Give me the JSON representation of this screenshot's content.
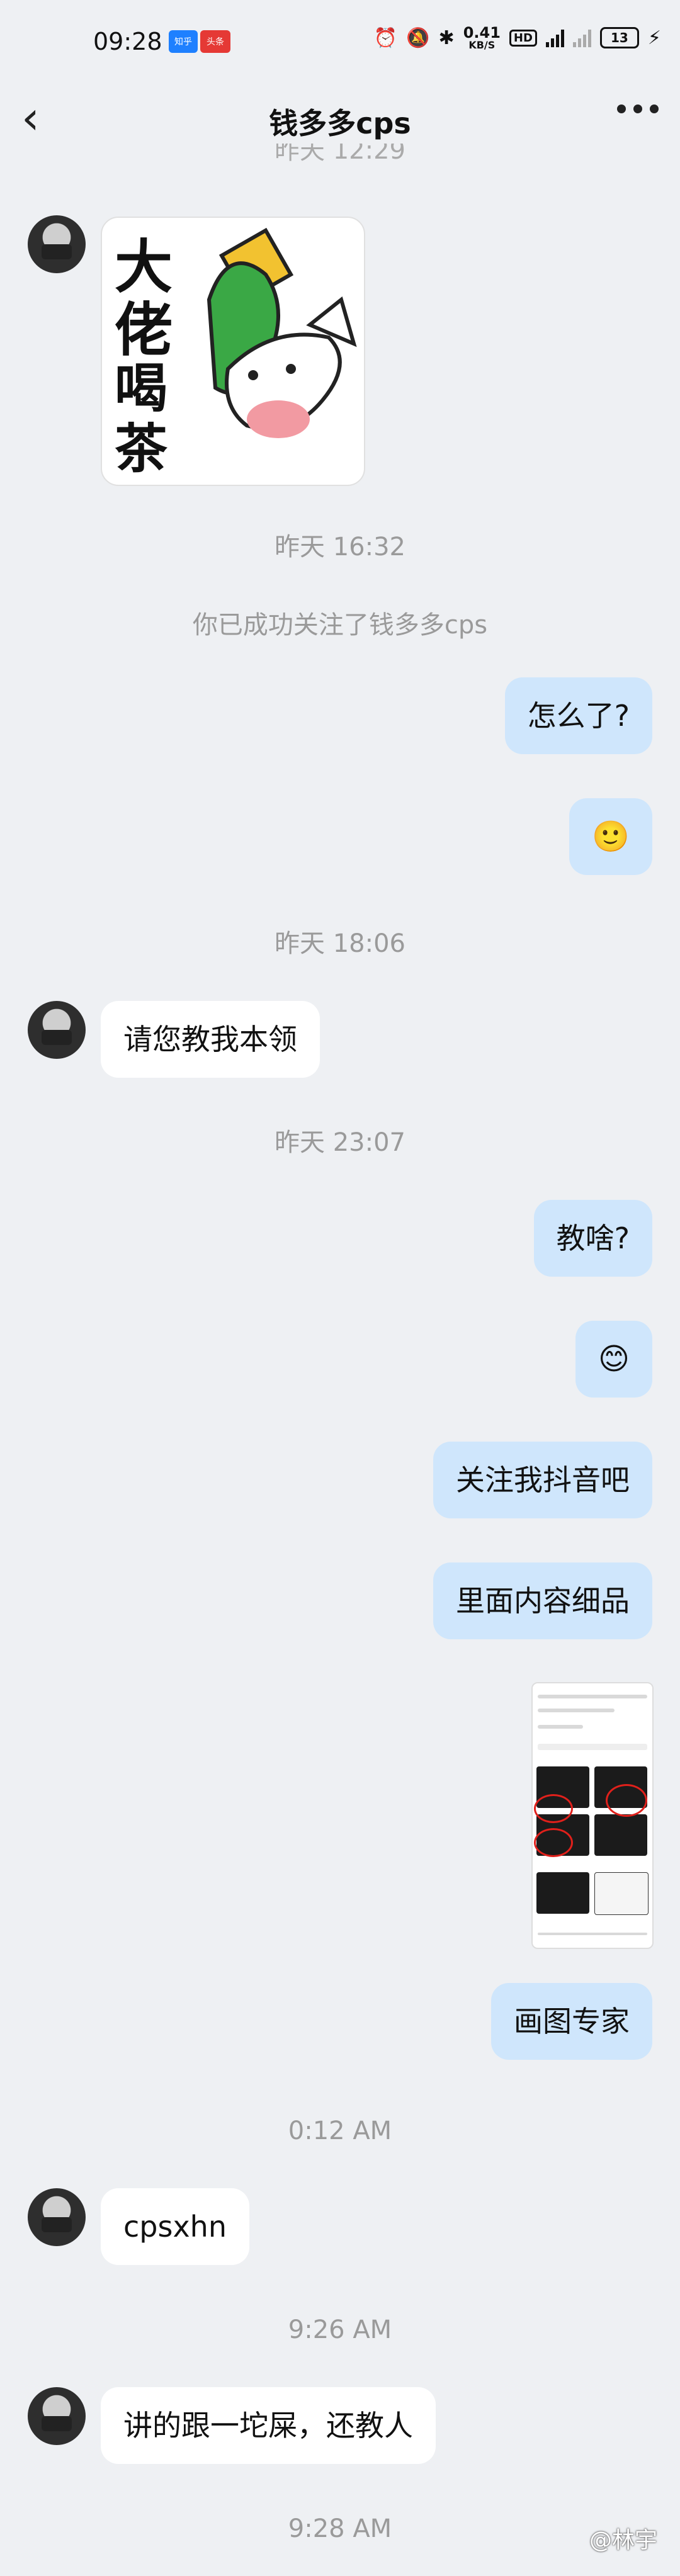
{
  "status_bar": {
    "time": "09:28",
    "badge_zhihu": "知乎",
    "badge_toutiao": "头条",
    "speed_value": "0.41",
    "speed_unit": "KB/S",
    "hd_label": "HD",
    "battery": "13"
  },
  "header": {
    "title": "钱多多cps"
  },
  "clipped_timestamp": "昨天 12:29",
  "messages": {
    "ts1": "昨天 16:32",
    "sys1": "你已成功关注了钱多多cps",
    "out1": "怎么了?",
    "out2": "🙂",
    "ts2": "昨天 18:06",
    "in1": "请您教我本领",
    "ts3": "昨天 23:07",
    "out3": "教啥?",
    "out4": "😊",
    "out5": "关注我抖音吧",
    "out6": "里面内容细品",
    "out7": "画图专家",
    "ts4": "0:12 AM",
    "in2": "cpsxhn",
    "ts5": "9:26 AM",
    "in3": "讲的跟一坨屎，还教人",
    "ts6": "9:28 AM"
  },
  "sticker": {
    "text_line1": "大佬",
    "text_line2": "喝茶"
  },
  "watermark": "@林宇",
  "colors": {
    "background": "#eef0f3",
    "bubble_out": "#cfe6fc",
    "bubble_in": "#ffffff",
    "timestamp": "#9a9a9a"
  }
}
